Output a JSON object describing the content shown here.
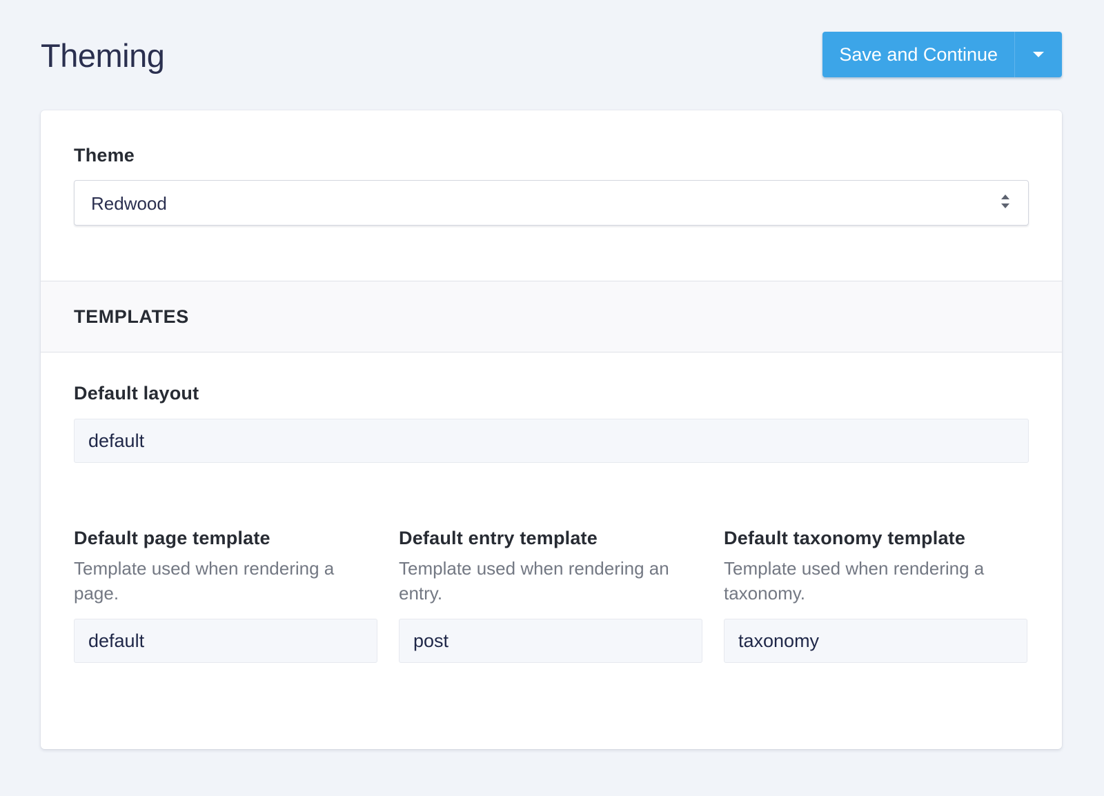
{
  "header": {
    "title": "Theming",
    "save_label": "Save and Continue"
  },
  "theme": {
    "label": "Theme",
    "selected": "Redwood"
  },
  "templates": {
    "section_title": "TEMPLATES",
    "default_layout": {
      "label": "Default layout",
      "value": "default"
    },
    "page_template": {
      "label": "Default page template",
      "help": "Template used when rendering a page.",
      "value": "default"
    },
    "entry_template": {
      "label": "Default entry template",
      "help": "Template used when rendering an entry.",
      "value": "post"
    },
    "taxonomy_template": {
      "label": "Default taxonomy template",
      "help": "Template used when rendering a taxonomy.",
      "value": "taxonomy"
    }
  },
  "colors": {
    "accent": "#3ca5e8",
    "background": "#f1f4f9",
    "input_background": "#f5f7fb"
  },
  "icons": {
    "dropdown": "caret-down-icon",
    "select": "select-arrows-icon"
  }
}
